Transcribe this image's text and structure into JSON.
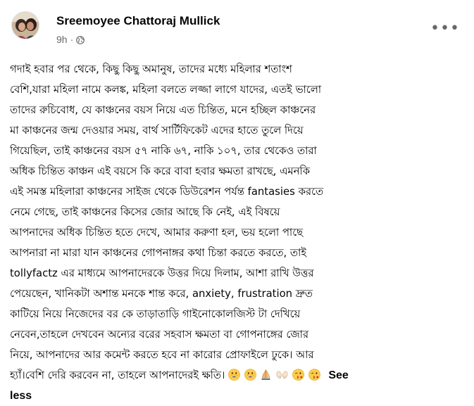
{
  "post": {
    "author": "Sreemoyee Chattoraj Mullick",
    "time": "9h",
    "separator": "·",
    "privacy_icon": "globe-icon",
    "more_icon": "more-options-icon",
    "more_label": "•••",
    "lines": [
      "গদাই হবার পর থেকে, কিছু কিছু অমানুষ, তাদের মধ্যে মহিলার শতাংশ",
      "বেশি,যারা মহিলা নামে কলঙ্ক, মহিলা বলতে লজ্জা লাগে যাদের, এতই ভালো",
      "তাদের রুচিবোধ, যে কাঞ্চনের বয়স নিয়ে এত চিন্তিত, মনে হচ্ছিল কাঞ্চনের",
      "মা কাঞ্চনের জন্ম দেওয়ার সময়, বার্থ সার্টিফিকেট এদের হাতে তুলে দিয়ে",
      "গিয়েছিল, তাই কাঞ্চনের বয়স ৫৭ নাকি ৬৭, নাকি ১০৭, তার থেকেও তারা",
      "অধিক চিন্তিত কাঞ্চন এই বয়সে কি করে বাবা হবার ক্ষমতা রাখছে, এমনকি",
      "এই সমস্ত মহিলারা কাঞ্চনের সাইজ থেকে ডিউরেশন পর্যন্ত fantasies করতে",
      "নেমে গেছে, তাই কাঞ্চনের কিসের জোর আছে কি নেই, এই বিষয়ে",
      "আপনাদের অধিক চিন্তিত হতে দেখে, আমার করুণা হল, ভয় হলো পাছে",
      "আপনারা না মারা যান কাঞ্চনের গোপনাঙ্গর কথা চিন্তা করতে করতে, তাই",
      "tollyfactz এর মাধ্যমে আপনাদেরকে উত্তর দিয়ে দিলাম, আশা রাখি উত্তর",
      "পেয়েছেন, খানিকটা অশান্ত মনকে শান্ত করে, anxiety, frustration দ্রুত",
      "কাটিয়ে নিয়ে নিজেদের বর কে তাড়াতাড়ি গাইনোকোলজিস্ট টা দেখিয়ে",
      "নেবেন,তাহলে দেখবেন অন্যের বরের সহবাস ক্ষমতা বা গোপনাঙ্গের জোর",
      "নিয়ে, আপনাদের আর কমেন্ট করতে হবে না কারোর প্রোফাইলে ঢুকে। আর"
    ],
    "last_line": "হ্যাঁ।বেশি দেরি করবেন না, তাহলে আপনাদেরই ক্ষতি।",
    "emojis": [
      "grinning-face-icon",
      "grinning-face-icon",
      "folded-hands-icon",
      "open-hands-icon",
      "face-blowing-kiss-icon",
      "face-blowing-kiss-icon"
    ],
    "see_less_1": "See",
    "see_less_2": "less"
  },
  "colors": {
    "text": "#050505",
    "secondary_text": "#65676b",
    "emoji_yellow": "#ffcb4c",
    "emoji_outline": "#e0a100"
  }
}
